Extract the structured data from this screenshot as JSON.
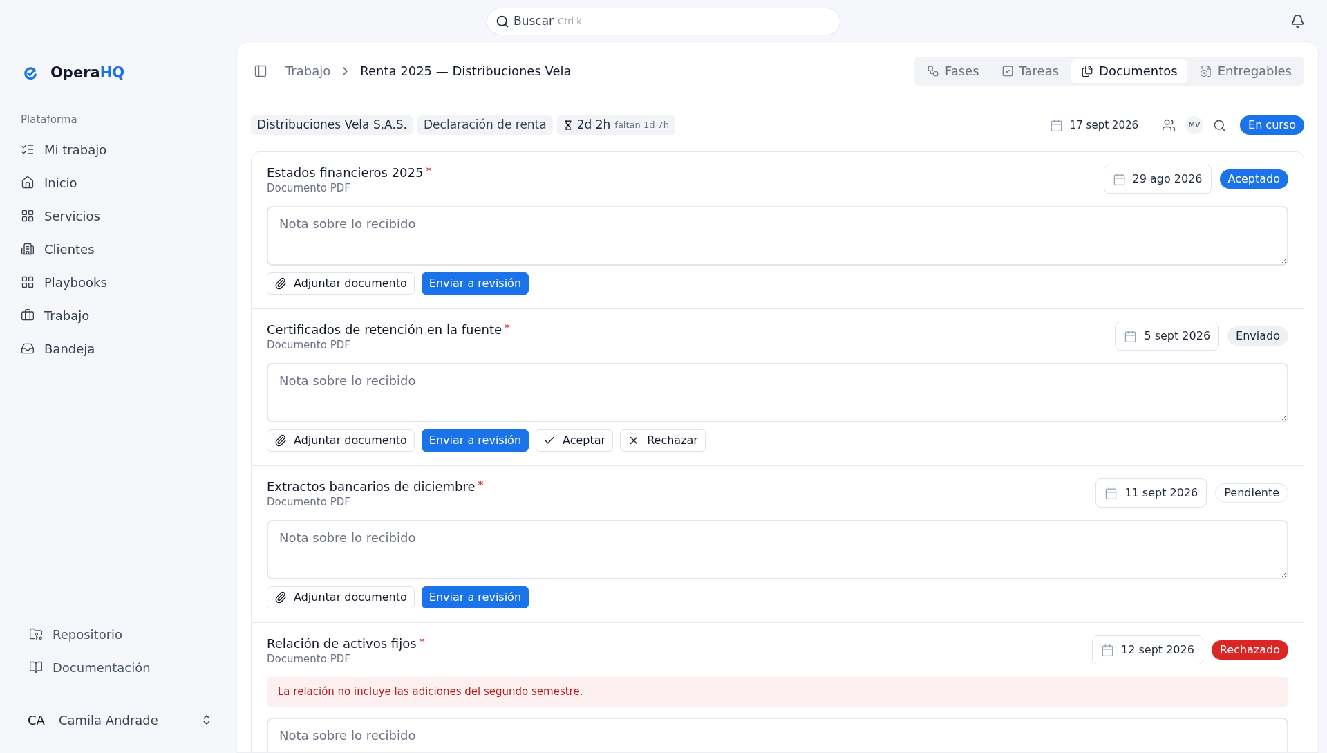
{
  "search": {
    "placeholder": "Buscar",
    "shortcut": "Ctrl k"
  },
  "sidebar": {
    "logo": {
      "name": "Opera",
      "accent": "HQ"
    },
    "section": "Plataforma",
    "items": [
      {
        "label": "Mi trabajo"
      },
      {
        "label": "Inicio"
      },
      {
        "label": "Servicios"
      },
      {
        "label": "Clientes"
      },
      {
        "label": "Playbooks"
      },
      {
        "label": "Trabajo"
      },
      {
        "label": "Bandeja"
      }
    ],
    "footer_items": [
      {
        "label": "Repositorio"
      },
      {
        "label": "Documentación"
      }
    ],
    "user": {
      "initials": "CA",
      "name": "Camila Andrade"
    }
  },
  "breadcrumb": [
    "Trabajo",
    "Renta 2025 — Distribuciones Vela"
  ],
  "tabs": [
    {
      "label": "Fases",
      "selected": false
    },
    {
      "label": "Tareas",
      "selected": false
    },
    {
      "label": "Documentos",
      "selected": true
    },
    {
      "label": "Entregables",
      "selected": false
    }
  ],
  "meta": {
    "client": "Distribuciones Vela S.A.S.",
    "service": "Declaración de renta",
    "duration": "2d 2h",
    "remaining": "faltan 1d 7h",
    "due_date": "17 sept 2026",
    "assignee": "MV",
    "status": "En curso"
  },
  "documents": [
    {
      "title": "Estados financieros 2025",
      "required_mark": "*",
      "type": "Documento PDF",
      "date": "29 ago 2026",
      "status": {
        "label": "Aceptado",
        "kind": "accepted"
      },
      "note_placeholder": "Nota sobre lo recibido",
      "actions": [
        {
          "label": "Adjuntar documento",
          "kind": "attach"
        },
        {
          "label": "Enviar a revisión",
          "kind": "submit"
        }
      ]
    },
    {
      "title": "Certificados de retención en la fuente",
      "required_mark": "*",
      "type": "Documento PDF",
      "date": "5 sept 2026",
      "status": {
        "label": "Enviado",
        "kind": "sent"
      },
      "note_placeholder": "Nota sobre lo recibido",
      "actions": [
        {
          "label": "Adjuntar documento",
          "kind": "attach"
        },
        {
          "label": "Enviar a revisión",
          "kind": "submit"
        },
        {
          "label": "Aceptar",
          "kind": "accept"
        },
        {
          "label": "Rechazar",
          "kind": "reject"
        }
      ]
    },
    {
      "title": "Extractos bancarios de diciembre",
      "required_mark": "*",
      "type": "Documento PDF",
      "date": "11 sept 2026",
      "status": {
        "label": "Pendiente",
        "kind": "pending"
      },
      "note_placeholder": "Nota sobre lo recibido",
      "actions": [
        {
          "label": "Adjuntar documento",
          "kind": "attach"
        },
        {
          "label": "Enviar a revisión",
          "kind": "submit"
        }
      ]
    },
    {
      "title": "Relación de activos fijos",
      "required_mark": "*",
      "type": "Documento PDF",
      "date": "12 sept 2026",
      "status": {
        "label": "Rechazado",
        "kind": "rejected"
      },
      "rejection_reason": "La relación no incluye las adiciones del segundo semestre.",
      "note_placeholder": "Nota sobre lo recibido"
    }
  ]
}
